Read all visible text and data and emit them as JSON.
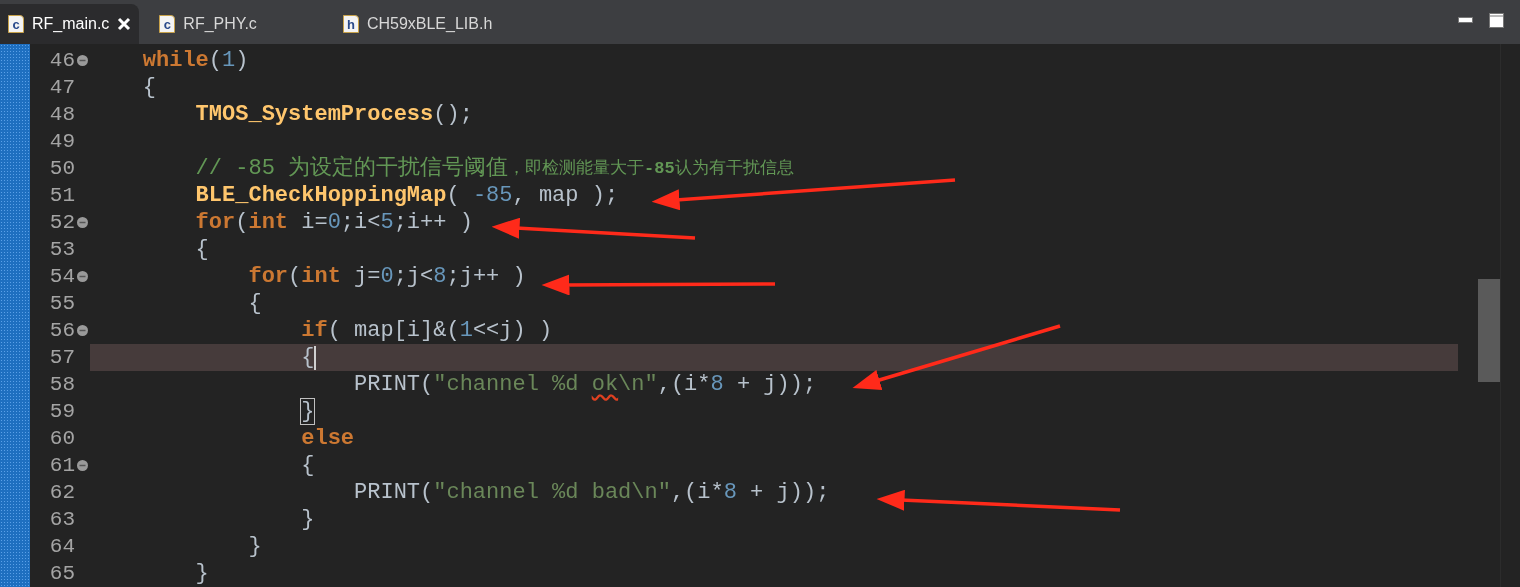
{
  "tabs": [
    {
      "label": "RF_main.c",
      "type": "c",
      "selected": true,
      "closable": true
    },
    {
      "label": "RF_PHY.c",
      "type": "c",
      "selected": false,
      "closable": false
    },
    {
      "label": "CH59xBLE_LIB.h",
      "type": "h",
      "selected": false,
      "closable": false
    }
  ],
  "lines": [
    {
      "number": "46",
      "fold": true,
      "current": false,
      "tokens": [
        {
          "kind": "kw",
          "text": "    while"
        },
        {
          "kind": "plain",
          "text": "("
        },
        {
          "kind": "num",
          "text": "1"
        },
        {
          "kind": "plain",
          "text": ")"
        }
      ]
    },
    {
      "number": "47",
      "fold": false,
      "current": false,
      "tokens": [
        {
          "kind": "plain",
          "text": "    {"
        }
      ]
    },
    {
      "number": "48",
      "fold": false,
      "current": false,
      "tokens": [
        {
          "kind": "func",
          "text": "        TMOS_SystemProcess"
        },
        {
          "kind": "plain",
          "text": "();"
        }
      ]
    },
    {
      "number": "49",
      "fold": false,
      "current": false
    },
    {
      "number": "50",
      "fold": false,
      "current": false,
      "tokens": [
        {
          "kind": "comment",
          "text": "        // -85 为设定的干扰信号阈值"
        },
        {
          "kind": "comment_small",
          "text": "，即检测能量大于**-85**认为有干扰信息"
        }
      ]
    },
    {
      "number": "51",
      "fold": false,
      "current": false,
      "tokens": [
        {
          "kind": "func",
          "text": "        BLE_CheckHoppingMap"
        },
        {
          "kind": "plain",
          "text": "( "
        },
        {
          "kind": "num",
          "text": "-85"
        },
        {
          "kind": "plain",
          "text": ", map );"
        }
      ]
    },
    {
      "number": "52",
      "fold": true,
      "current": false,
      "tokens": [
        {
          "kind": "kw",
          "text": "        for"
        },
        {
          "kind": "plain",
          "text": "("
        },
        {
          "kind": "kw",
          "text": "int"
        },
        {
          "kind": "plain",
          "text": " i="
        },
        {
          "kind": "num",
          "text": "0"
        },
        {
          "kind": "plain",
          "text": ";i<"
        },
        {
          "kind": "num",
          "text": "5"
        },
        {
          "kind": "plain",
          "text": ";i++ )"
        }
      ]
    },
    {
      "number": "53",
      "fold": false,
      "current": false,
      "tokens": [
        {
          "kind": "plain",
          "text": "        {"
        }
      ]
    },
    {
      "number": "54",
      "fold": true,
      "current": false,
      "tokens": [
        {
          "kind": "kw",
          "text": "            for"
        },
        {
          "kind": "plain",
          "text": "("
        },
        {
          "kind": "kw",
          "text": "int"
        },
        {
          "kind": "plain",
          "text": " j="
        },
        {
          "kind": "num",
          "text": "0"
        },
        {
          "kind": "plain",
          "text": ";j<"
        },
        {
          "kind": "num",
          "text": "8"
        },
        {
          "kind": "plain",
          "text": ";j++ )"
        }
      ]
    },
    {
      "number": "55",
      "fold": false,
      "current": false,
      "tokens": [
        {
          "kind": "plain",
          "text": "            {"
        }
      ]
    },
    {
      "number": "56",
      "fold": true,
      "current": false,
      "tokens": [
        {
          "kind": "kw",
          "text": "                if"
        },
        {
          "kind": "plain",
          "text": "( map[i]&("
        },
        {
          "kind": "num",
          "text": "1"
        },
        {
          "kind": "plain",
          "text": "<<j) )"
        }
      ]
    },
    {
      "number": "57",
      "fold": false,
      "current": true,
      "cursor": true,
      "tokens": [
        {
          "kind": "plain",
          "text": "                {"
        }
      ]
    },
    {
      "number": "58",
      "fold": false,
      "current": false,
      "tokens": [
        {
          "kind": "plain",
          "text": "                    PRINT("
        },
        {
          "kind": "string",
          "text": "\"channel %d "
        },
        {
          "kind": "string_squiggle",
          "text": "ok"
        },
        {
          "kind": "string",
          "text": "\\n\""
        },
        {
          "kind": "plain",
          "text": ",(i*"
        },
        {
          "kind": "num",
          "text": "8"
        },
        {
          "kind": "plain",
          "text": " + j));"
        }
      ]
    },
    {
      "number": "59",
      "fold": false,
      "current": false,
      "tokens": [
        {
          "kind": "matched",
          "text": "                }"
        }
      ]
    },
    {
      "number": "60",
      "fold": false,
      "current": false,
      "tokens": [
        {
          "kind": "kw",
          "text": "                else"
        }
      ]
    },
    {
      "number": "61",
      "fold": true,
      "current": false,
      "tokens": [
        {
          "kind": "plain",
          "text": "                {"
        }
      ]
    },
    {
      "number": "62",
      "fold": false,
      "current": false,
      "tokens": [
        {
          "kind": "plain",
          "text": "                    PRINT("
        },
        {
          "kind": "string",
          "text": "\"channel %d bad\\n\""
        },
        {
          "kind": "plain",
          "text": ",(i*"
        },
        {
          "kind": "num",
          "text": "8"
        },
        {
          "kind": "plain",
          "text": " + j));"
        }
      ]
    },
    {
      "number": "63",
      "fold": false,
      "current": false,
      "tokens": [
        {
          "kind": "plain",
          "text": "                }"
        }
      ]
    },
    {
      "number": "64",
      "fold": false,
      "current": false,
      "tokens": [
        {
          "kind": "plain",
          "text": "            }"
        }
      ]
    },
    {
      "number": "65",
      "fold": false,
      "current": false,
      "tokens": [
        {
          "kind": "plain",
          "text": "        }"
        }
      ]
    }
  ]
}
